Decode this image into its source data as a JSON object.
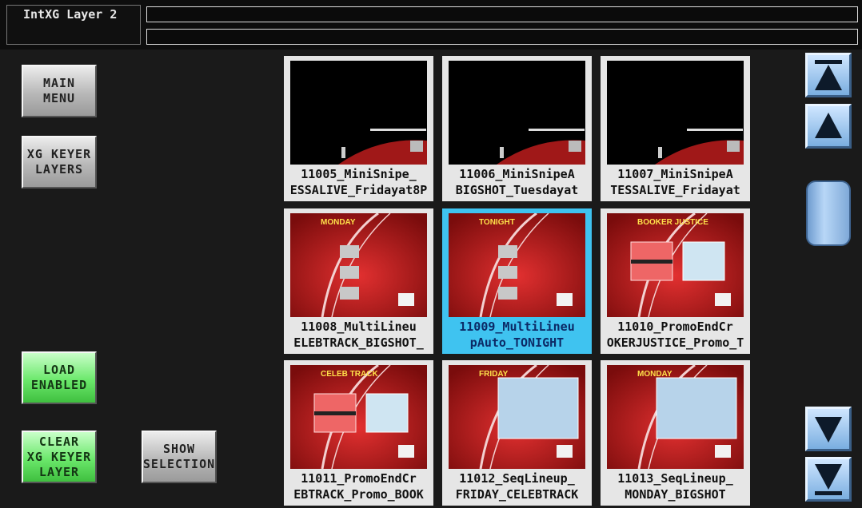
{
  "header": {
    "title": "IntXG Layer 2",
    "status_line_1": "",
    "status_line_2": ""
  },
  "left_panel": {
    "main_menu": "MAIN\nMENU",
    "xg_keyer_layers": "XG KEYER\nLAYERS",
    "load_enabled": "LOAD\nENABLED",
    "clear_layer": "CLEAR\nXG KEYER\nLAYER",
    "show_selection": "SHOW\nSELECTION"
  },
  "colors": {
    "green_button": "#4fd34f",
    "selection": "#3fc3f0",
    "scroll_blue": "#8fbbe8"
  },
  "thumbnails": [
    {
      "line1": "11005_MiniSnipe_",
      "line2": "ESSALIVE_Fridayat8P",
      "style": "black",
      "selected": false
    },
    {
      "line1": "11006_MiniSnipeA",
      "line2": "BIGSHOT_Tuesdayat",
      "style": "black",
      "selected": false
    },
    {
      "line1": "11007_MiniSnipeA",
      "line2": "TESSALIVE_Fridayat",
      "style": "black",
      "selected": false
    },
    {
      "line1": "11008_MultiLineu",
      "line2": "ELEBTRACK_BIGSHOT_",
      "style": "red",
      "label": "MONDAY",
      "selected": false
    },
    {
      "line1": "11009_MultiLineu",
      "line2": "pAuto_TONIGHT",
      "style": "red",
      "label": "TONIGHT",
      "selected": true
    },
    {
      "line1": "11010_PromoEndCr",
      "line2": "OKERJUSTICE_Promo_T",
      "style": "red",
      "label": "BOOKER JUSTICE",
      "selected": false
    },
    {
      "line1": "11011_PromoEndCr",
      "line2": "EBTRACK_Promo_BOOK",
      "style": "red",
      "label": "CELEB TRACK",
      "selected": false
    },
    {
      "line1": "11012_SeqLineup_",
      "line2": "FRIDAY_CELEBTRACK",
      "style": "red",
      "label": "FRIDAY",
      "selected": false
    },
    {
      "line1": "11013_SeqLineup_",
      "line2": "MONDAY_BIGSHOT",
      "style": "red",
      "label": "MONDAY",
      "selected": false
    }
  ],
  "scroll": {
    "top_icon": "scroll-top-icon",
    "up_icon": "scroll-up-icon",
    "down_icon": "scroll-down-icon",
    "bottom_icon": "scroll-bottom-icon"
  }
}
